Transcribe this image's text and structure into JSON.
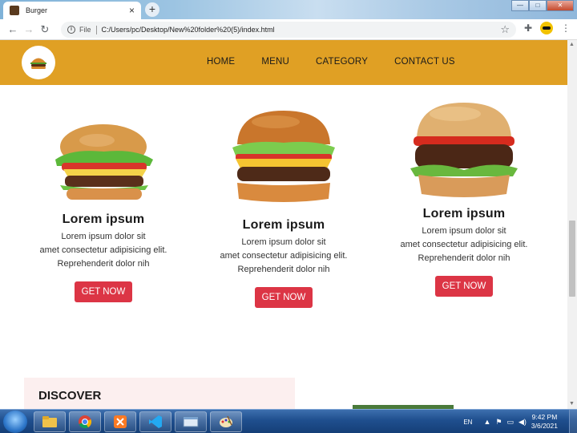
{
  "browser": {
    "tab_title": "Burger",
    "tab_close": "×",
    "new_tab": "+",
    "scheme": "File",
    "url": "C:/Users/pc/Desktop/New%20folder%20(5)/index.html"
  },
  "site": {
    "nav": [
      "HOME",
      "MENU",
      "CATEGORY",
      "CONTACT US"
    ],
    "cards": [
      {
        "title": "Lorem ipsum",
        "line1": "Lorem ipsum dolor sit",
        "line2": "amet consectetur adipisicing elit.",
        "line3": "Reprehenderit dolor nih",
        "button": "GET NOW"
      },
      {
        "title": "Lorem ipsum",
        "line1": "Lorem ipsum dolor sit",
        "line2": "amet consectetur adipisicing elit.",
        "line3": "Reprehenderit dolor nih",
        "button": "GET NOW"
      },
      {
        "title": "Lorem ipsum",
        "line1": "Lorem ipsum dolor sit",
        "line2": "amet consectetur adipisicing elit.",
        "line3": "Reprehenderit dolor nih",
        "button": "GET NOW"
      }
    ],
    "discover_title": "DISCOVER"
  },
  "taskbar": {
    "lang": "EN",
    "time": "9:42 PM",
    "date": "3/6/2021"
  },
  "colors": {
    "nav_bg": "#e0a024",
    "button_bg": "#dc3545",
    "discover_bg": "#fcefef"
  },
  "icons": [
    "back-icon",
    "forward-icon",
    "reload-icon",
    "info-icon",
    "star-icon",
    "extensions-icon",
    "profile-avatar",
    "menu-icon",
    "burger-logo-icon"
  ]
}
